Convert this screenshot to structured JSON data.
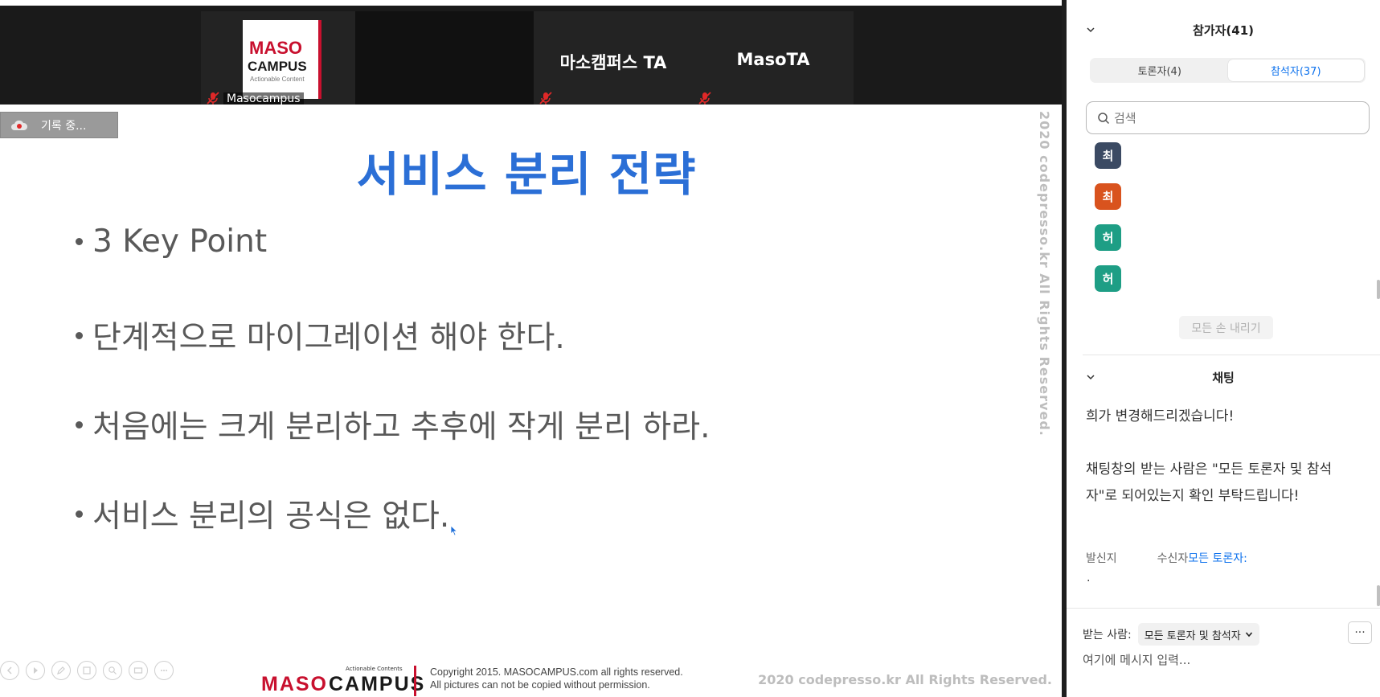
{
  "video": {
    "tiles": [
      {
        "name": "Masocampus",
        "logo_line1": "MASO",
        "logo_line2": "CAMPUS",
        "logo_line3": "Actionable Content"
      },
      {
        "name": "마소캠퍼스 TA"
      },
      {
        "name": "MasoTA"
      }
    ]
  },
  "slide": {
    "recording_label": "기록 중...",
    "title": "서비스 분리 전략",
    "bullets": [
      "3 Key Point",
      "단계적으로 마이그레이션 해야 한다.",
      "처음에는 크게 분리하고 추후에 작게 분리 하라.",
      "서비스 분리의 공식은 없다."
    ],
    "watermark": "2020 codepresso.kr All Rights Reserved.",
    "footer": {
      "logo_tag": "Actionable Contents",
      "logo_maso": "MASO",
      "logo_campus": "CAMPUS",
      "copyright_line1": "Copyright 2015. MASOCAMPUS.com all rights reserved.",
      "copyright_line2": "All pictures can not be copied without permission.",
      "right_text": "2020 codepresso.kr All Rights Reserved."
    }
  },
  "panel": {
    "participants_header": "참가자(41)",
    "tabs": [
      {
        "label": "토론자(4)",
        "active": false
      },
      {
        "label": "참석자(37)",
        "active": true
      }
    ],
    "search_placeholder": "검색",
    "participants": [
      {
        "initial": "최",
        "color": "#3b4a63"
      },
      {
        "initial": "최",
        "color": "#d9531e"
      },
      {
        "initial": "허",
        "color": "#1e9e85"
      },
      {
        "initial": "허",
        "color": "#1e9e85"
      }
    ],
    "lower_hands_label": "모든 손 내리기",
    "chat_header": "채팅",
    "chat_messages": [
      "희가 변경해드리겠습니다!",
      "채팅창의 받는 사람은 \"모든 토론자 및 참석자\"로 되어있는지 확인 부탁드립니다!"
    ],
    "sender_label": "발신지",
    "to_prefix": "수신자",
    "to_target": "모든 토론자:",
    "chat_dot": ".",
    "recipient_label": "받는 사람:",
    "recipient_value": "모든 토론자 및 참석자",
    "more_label": "···",
    "message_placeholder": "여기에 메시지 입력..."
  }
}
